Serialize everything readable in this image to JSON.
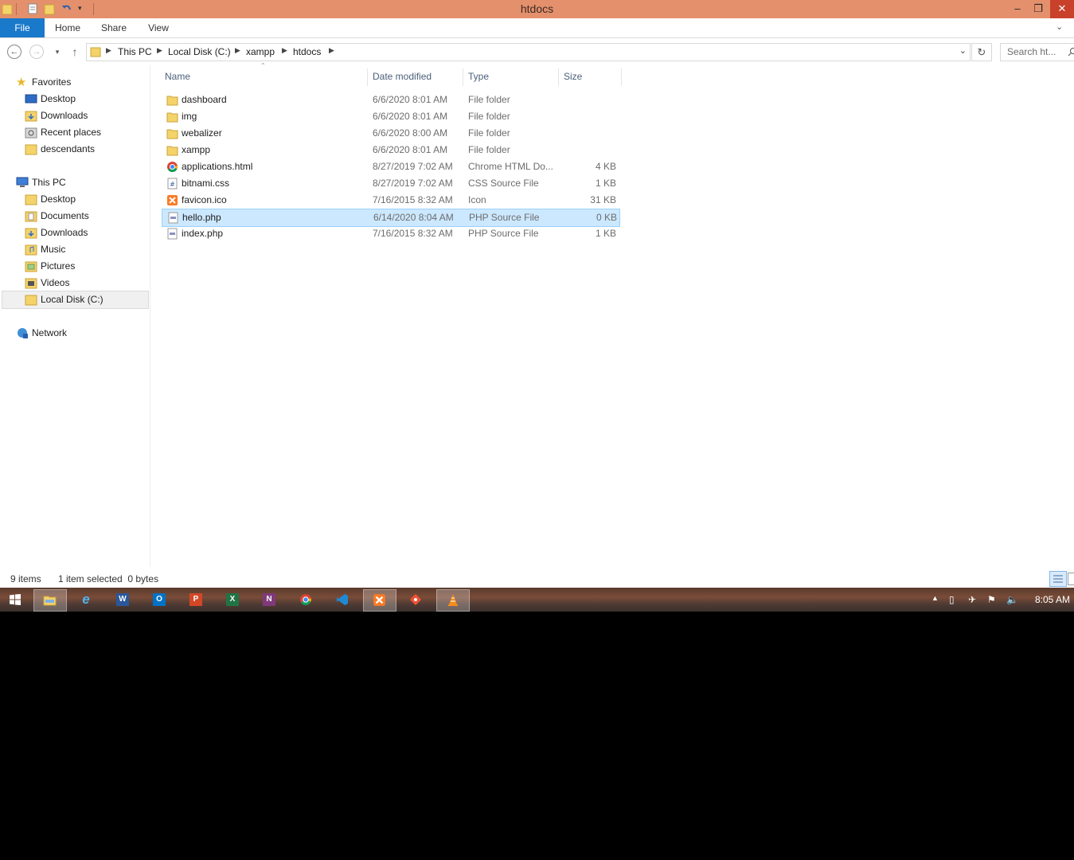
{
  "window": {
    "title": "htdocs",
    "controls": {
      "minimize": "‒",
      "restore": "❐",
      "close": "✕"
    },
    "qat_icons": [
      "folder-icon",
      "properties-icon",
      "new-folder-icon",
      "undo-icon",
      "customize-icon"
    ]
  },
  "ribbon": {
    "tabs": [
      "File",
      "Home",
      "Share",
      "View"
    ],
    "expand_icon": "chevron-down-icon"
  },
  "address": {
    "crumbs": [
      "This PC",
      "Local Disk (C:)",
      "xampp",
      "htdocs"
    ],
    "search_placeholder": "Search ht..."
  },
  "nav": {
    "favorites_label": "Favorites",
    "favorites": [
      "Desktop",
      "Downloads",
      "Recent places",
      "descendants"
    ],
    "thispc_label": "This PC",
    "thispc": [
      "Desktop",
      "Documents",
      "Downloads",
      "Music",
      "Pictures",
      "Videos",
      "Local Disk (C:)"
    ],
    "network_label": "Network"
  },
  "columns": {
    "name": "Name",
    "date": "Date modified",
    "type": "Type",
    "size": "Size"
  },
  "files": [
    {
      "name": "dashboard",
      "date": "6/6/2020 8:01 AM",
      "type": "File folder",
      "size": "",
      "icon": "folder-icon"
    },
    {
      "name": "img",
      "date": "6/6/2020 8:01 AM",
      "type": "File folder",
      "size": "",
      "icon": "folder-icon"
    },
    {
      "name": "webalizer",
      "date": "6/6/2020 8:00 AM",
      "type": "File folder",
      "size": "",
      "icon": "folder-icon"
    },
    {
      "name": "xampp",
      "date": "6/6/2020 8:01 AM",
      "type": "File folder",
      "size": "",
      "icon": "folder-icon"
    },
    {
      "name": "applications.html",
      "date": "8/27/2019 7:02 AM",
      "type": "Chrome HTML Do...",
      "size": "4 KB",
      "icon": "chrome-icon"
    },
    {
      "name": "bitnami.css",
      "date": "8/27/2019 7:02 AM",
      "type": "CSS Source File",
      "size": "1 KB",
      "icon": "css-file-icon"
    },
    {
      "name": "favicon.ico",
      "date": "7/16/2015 8:32 AM",
      "type": "Icon",
      "size": "31 KB",
      "icon": "xampp-icon"
    },
    {
      "name": "hello.php",
      "date": "6/14/2020 8:04 AM",
      "type": "PHP Source File",
      "size": "0 KB",
      "icon": "php-file-icon"
    },
    {
      "name": "index.php",
      "date": "7/16/2015 8:32 AM",
      "type": "PHP Source File",
      "size": "1 KB",
      "icon": "php-file-icon"
    }
  ],
  "selected_file": "hello.php",
  "status": {
    "count": "9 items",
    "selection": "1 item selected  0 bytes"
  },
  "taskbar": {
    "apps": [
      "start-icon",
      "file-explorer-icon",
      "internet-explorer-icon",
      "word-icon",
      "outlook-icon",
      "powerpoint-icon",
      "excel-icon",
      "onenote-icon",
      "chrome-icon",
      "vscode-icon",
      "xampp-icon",
      "git-icon",
      "vlc-icon"
    ],
    "app_letters": {
      "word-icon": "W",
      "outlook-icon": "O",
      "powerpoint-icon": "P",
      "excel-icon": "X",
      "onenote-icon": "N"
    },
    "clock": "8:05 AM"
  },
  "colors": {
    "titlebar": "#e4906c",
    "file_tab": "#1979ca",
    "selection": "#cce8ff",
    "selection_border": "#99d1ff",
    "header_text": "#4c607a"
  }
}
